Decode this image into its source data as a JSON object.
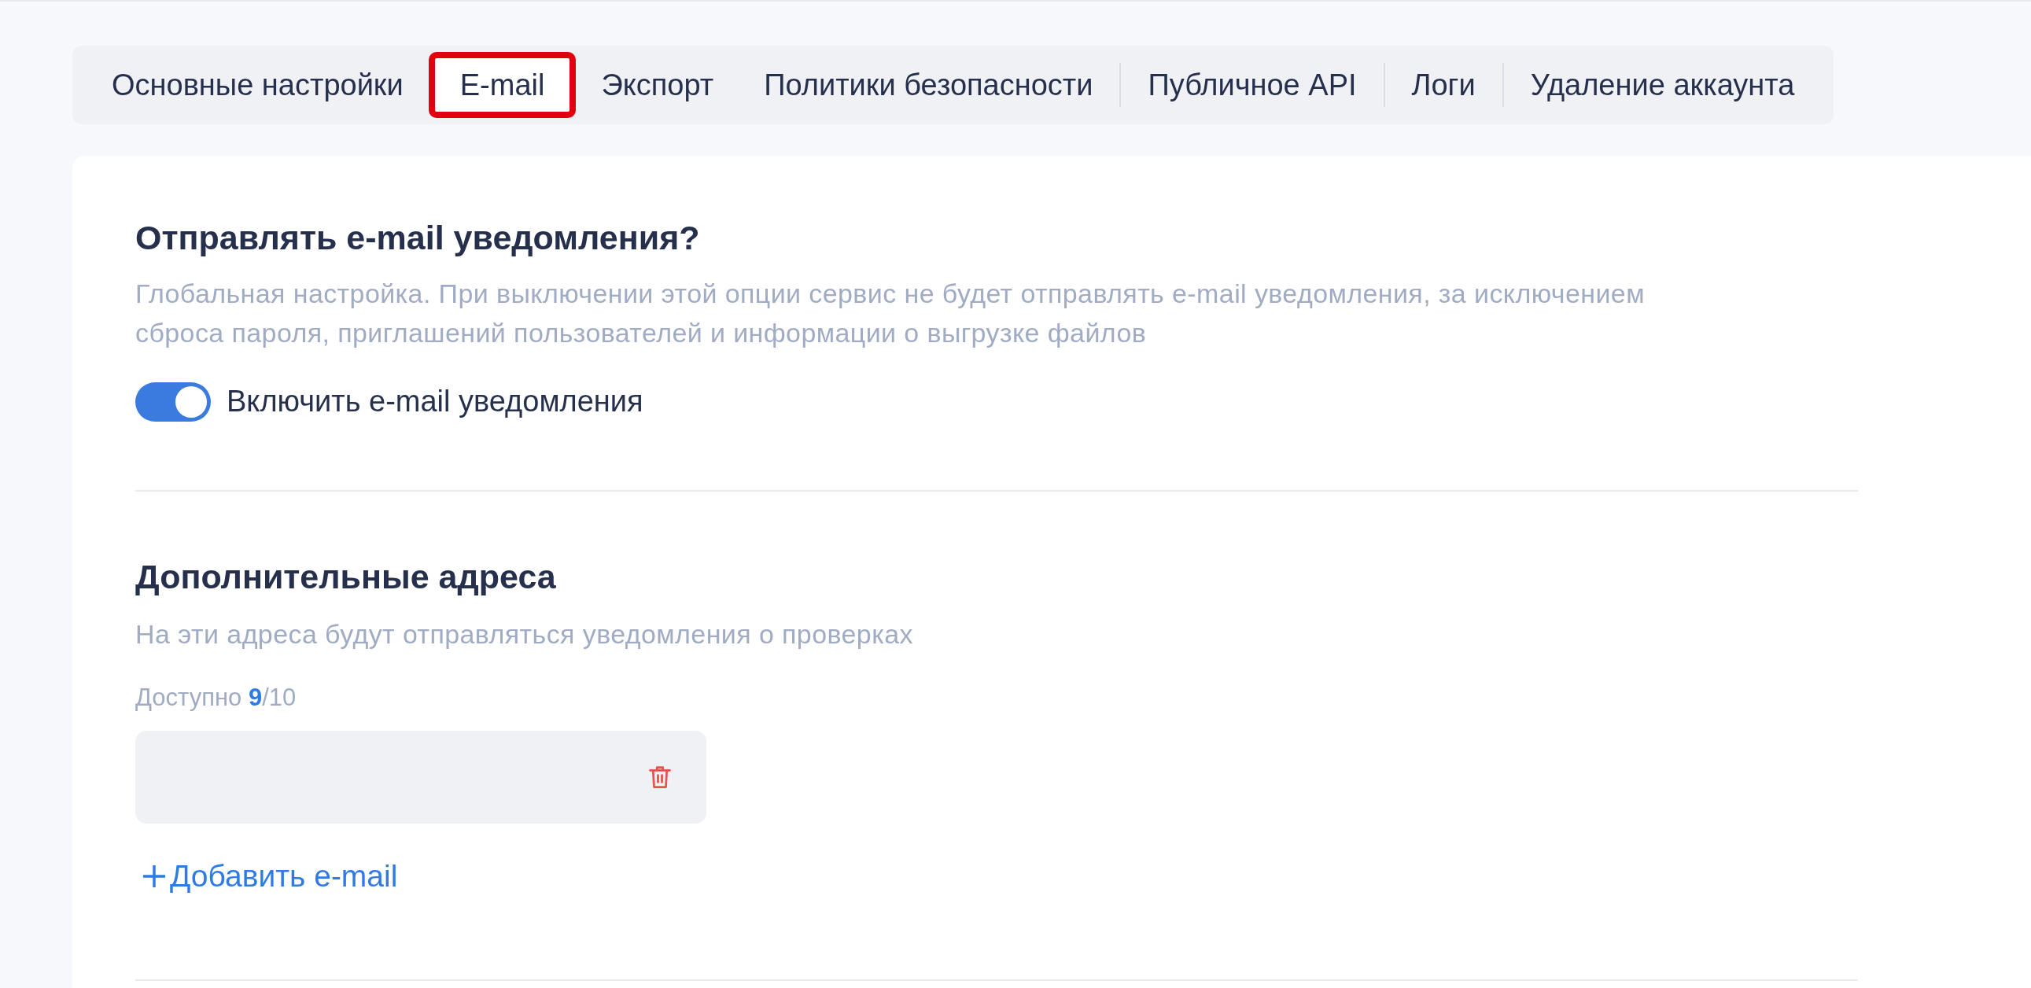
{
  "tabs": [
    {
      "label": "Основные настройки",
      "selected": false,
      "highlighted": false
    },
    {
      "label": "E-mail",
      "selected": true,
      "highlighted": true
    },
    {
      "label": "Экспорт",
      "selected": false,
      "highlighted": false
    },
    {
      "label": "Политики безопасности",
      "selected": false,
      "highlighted": false
    },
    {
      "label": "Публичное API",
      "selected": false,
      "highlighted": false
    },
    {
      "label": "Логи",
      "selected": false,
      "highlighted": false
    },
    {
      "label": "Удаление аккаунта",
      "selected": false,
      "highlighted": false
    }
  ],
  "notifications": {
    "title": "Отправлять e-mail уведомления?",
    "description": "Глобальная настройка. При выключении этой опции сервис не будет отправлять e-mail уведомления, за исключением сброса пароля, приглашений пользователей и информации о выгрузке файлов",
    "toggle": {
      "label": "Включить e-mail уведомления",
      "on": true
    }
  },
  "extra_addresses": {
    "title": "Дополнительные адреса",
    "description": "На эти адреса будут отправляться уведомления о проверках",
    "available": "Доступно **9**/10",
    "emails": [
      {
        "removable": true
      }
    ],
    "add_link": "Добавить e-mail"
  }
}
